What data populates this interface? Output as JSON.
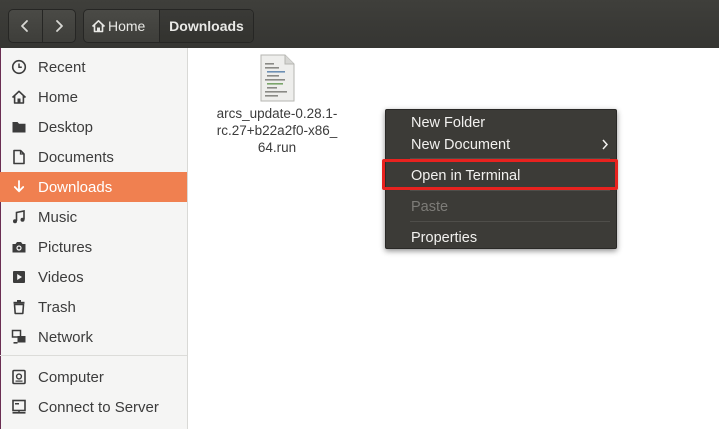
{
  "header": {
    "back_label": "Back",
    "forward_label": "Forward",
    "breadcrumbs": [
      {
        "label": "Home",
        "icon": "home-icon"
      },
      {
        "label": "Downloads"
      }
    ]
  },
  "sidebar": {
    "items": [
      {
        "label": "Recent",
        "icon": "clock-icon"
      },
      {
        "label": "Home",
        "icon": "home-icon"
      },
      {
        "label": "Desktop",
        "icon": "folder-icon"
      },
      {
        "label": "Documents",
        "icon": "document-icon"
      },
      {
        "label": "Downloads",
        "icon": "download-icon",
        "active": true
      },
      {
        "label": "Music",
        "icon": "music-icon"
      },
      {
        "label": "Pictures",
        "icon": "camera-icon"
      },
      {
        "label": "Videos",
        "icon": "video-icon"
      },
      {
        "label": "Trash",
        "icon": "trash-icon"
      },
      {
        "label": "Network",
        "icon": "network-icon"
      },
      {
        "label": "Computer",
        "icon": "computer-icon"
      },
      {
        "label": "Connect to Server",
        "icon": "server-icon"
      }
    ]
  },
  "files": [
    {
      "name": "arcs_update-0.28.1-\nrc.27+b22a2f0-x86_\n64.run",
      "icon": "script-file-icon"
    }
  ],
  "context_menu": {
    "items": [
      {
        "label": "New Folder"
      },
      {
        "label": "New Document",
        "has_submenu": true
      },
      {
        "label": "Open in Terminal",
        "highlighted": true
      },
      {
        "label": "Paste",
        "disabled": true
      },
      {
        "label": "Properties"
      }
    ]
  },
  "colors": {
    "accent": "#f08050",
    "headerbar": "#3a3a36",
    "menu_bg": "#3c3b37",
    "highlight_box": "#e8221f"
  }
}
